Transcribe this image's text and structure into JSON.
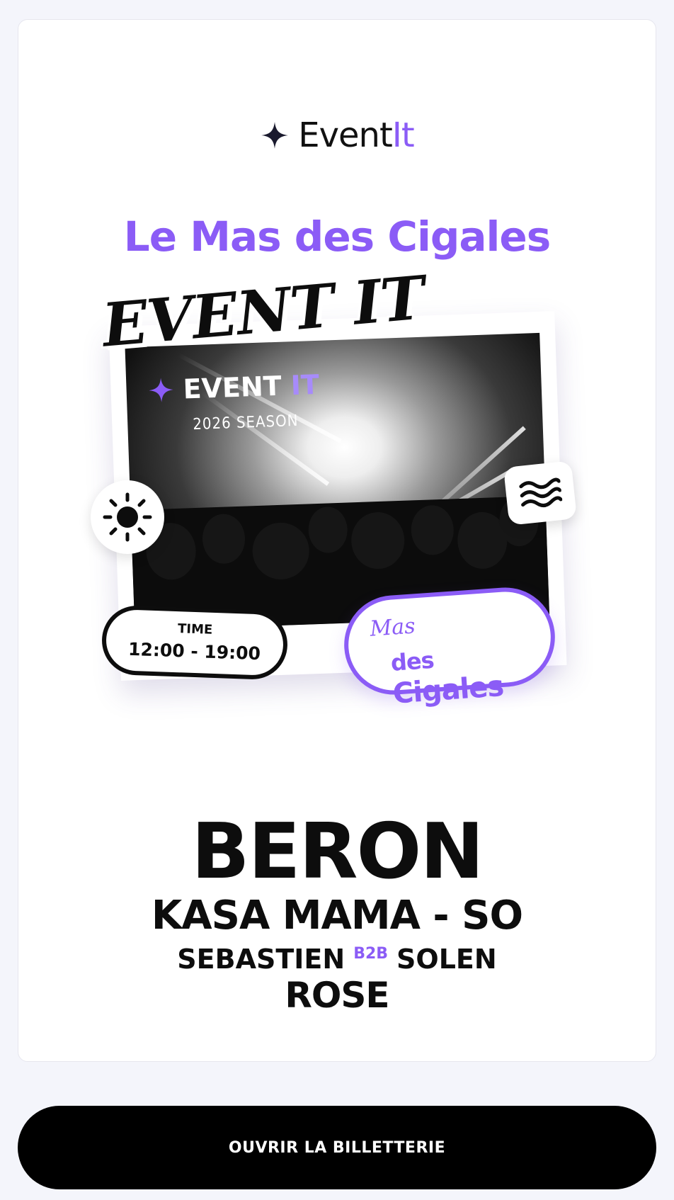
{
  "brand": {
    "name_main": "Event",
    "name_accent": "It",
    "accent_color": "#8b5cf6",
    "icon": "sparkle-star-icon"
  },
  "venue": {
    "title": "Le Mas des Cigales"
  },
  "poster": {
    "overlay_title": "EVENT IT",
    "photo_brand_main": "EVENT",
    "photo_brand_accent": "IT",
    "season": "2026 SEASON",
    "sun_icon": "sun-icon",
    "waves_icon": "waves-icon",
    "time_label": "TIME",
    "time_value": "12:00 - 19:00",
    "venue_small": "Mas",
    "venue_des": "des",
    "venue_big": "Cigales"
  },
  "lineup": {
    "headliner": "BERON",
    "act2": "KASA MAMA - SO",
    "act3_left": "SEBASTIEN",
    "act3_tag": "B2B",
    "act3_right": "SOLEN",
    "act4": "ROSE"
  },
  "cta": {
    "label": "OUVRIR LA BILLETTERIE"
  }
}
